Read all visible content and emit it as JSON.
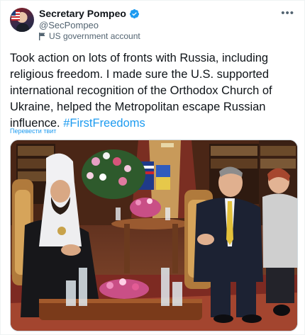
{
  "author": {
    "display_name": "Secretary Pompeo",
    "handle": "@SecPompeo",
    "label": "US government account"
  },
  "tweet": {
    "text": "Took action on lots of fronts with Russia, including religious freedom. I made sure the U.S. supported international recognition of the Orthodox Church of Ukraine, helped the Metropolitan escape Russian influence.",
    "hashtag": "#FirstFreedoms",
    "translate_label": "Перевести твит"
  },
  "icons": {
    "verified": "verified-badge-icon",
    "government": "government-flag-icon",
    "more": "more-options-icon"
  },
  "colors": {
    "accent": "#1d9bf0",
    "text": "#0f1419",
    "secondary": "#536471"
  }
}
